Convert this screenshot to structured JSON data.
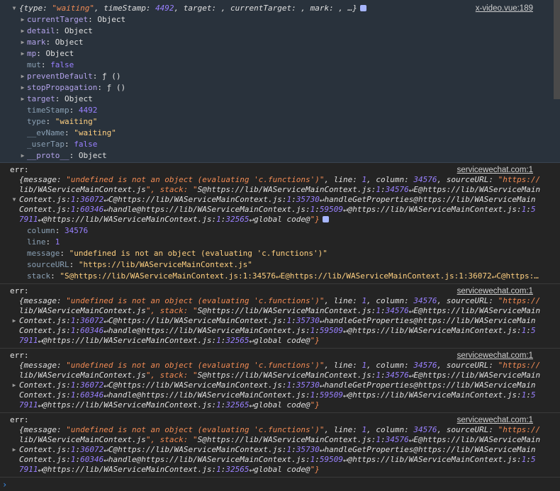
{
  "first_entry": {
    "summary_prefix": "{type: ",
    "summary_type": "\"waiting\"",
    "summary_mid": ", timeStamp: ",
    "summary_ts": "4492",
    "summary_rest": ", target: , currentTarget: , mark: , …}",
    "source": "x-video.vue:189",
    "props": [
      {
        "key": "currentTarget",
        "sep": ": ",
        "value": "Object",
        "expandable": true,
        "kind": "plain"
      },
      {
        "key": "detail",
        "sep": ": ",
        "value": "Object",
        "expandable": true,
        "kind": "plain"
      },
      {
        "key": "mark",
        "sep": ": ",
        "value": "Object",
        "expandable": true,
        "kind": "plain"
      },
      {
        "key": "mp",
        "sep": ": ",
        "value": "Object",
        "expandable": true,
        "kind": "plain"
      },
      {
        "key": "mut",
        "sep": ": ",
        "value": "false",
        "expandable": false,
        "kind": "bool"
      },
      {
        "key": "preventDefault",
        "sep": ": ",
        "value": "ƒ ()",
        "expandable": true,
        "kind": "plain"
      },
      {
        "key": "stopPropagation",
        "sep": ": ",
        "value": "ƒ ()",
        "expandable": true,
        "kind": "plain"
      },
      {
        "key": "target",
        "sep": ": ",
        "value": "Object",
        "expandable": true,
        "kind": "plain"
      },
      {
        "key": "timeStamp",
        "sep": ": ",
        "value": "4492",
        "expandable": false,
        "kind": "num"
      },
      {
        "key": "type",
        "sep": ": ",
        "value": "\"waiting\"",
        "expandable": false,
        "kind": "str"
      },
      {
        "key": "__evName",
        "sep": ": ",
        "value": "\"waiting\"",
        "expandable": false,
        "kind": "str"
      },
      {
        "key": "_userTap",
        "sep": ": ",
        "value": "false",
        "expandable": false,
        "kind": "bool"
      },
      {
        "key": "__proto__",
        "sep": ": ",
        "value": "Object",
        "expandable": true,
        "kind": "plain"
      }
    ]
  },
  "err_entries": [
    {
      "label": "err:",
      "source": "servicewechat.com:1",
      "expanded": true,
      "lines": [
        "{message: \"undefined is not an object (evaluating 'c.functions')\", line: 1, column: 34576, sourceURL: \"https://",
        "lib/WAService​MainContext.js\", stack: \"S@https://lib/WAServiceMainContext.js:1:34576↵E@https://lib/WAServiceMain",
        "Context.js:1:36072↵C@https://lib/WAServiceMainContext.js:1:35730↵handleGetProperties@https://lib/WAServiceMain",
        "Context.js:1:60346↵handle@https://lib/WAServiceMainContext.js:1:59509↵@https://lib/WAServiceMainContext.js:1:5",
        "7911↵@https://lib/WAServiceMainContext.js:1:32565↵global code@\"}"
      ],
      "props": [
        {
          "key": "column",
          "value": "34576",
          "kind": "num"
        },
        {
          "key": "line",
          "value": "1",
          "kind": "num"
        },
        {
          "key": "message",
          "value": "\"undefined is not an object (evaluating 'c.functions')\"",
          "kind": "strw"
        },
        {
          "key": "sourceURL",
          "value": "\"https://lib/WAServiceMainContext.js\"",
          "kind": "strw"
        },
        {
          "key": "stack",
          "value": "\"S@https://lib/WAServiceMainContext.js:1:34576↵E@https://lib/WAServiceMainContext.js:1:36072↵C@https:…",
          "kind": "strw"
        }
      ]
    },
    {
      "label": "err:",
      "source": "servicewechat.com:1",
      "expanded": false,
      "lines": [
        "{message: \"undefined is not an object (evaluating 'c.functions')\", line: 1, column: 34576, sourceURL: \"https://",
        "lib/WAServiceMainContext.js\", stack: \"S@https://lib/WAServiceMainContext.js:1:34576↵E@https://lib/WAServiceMain",
        "Context.js:1:36072↵C@https://lib/WAServiceMainContext.js:1:35730↵handleGetProperties@https://lib/WAServiceMain",
        "Context.js:1:60346↵handle@https://lib/WAServiceMainContext.js:1:59509↵@https://lib/WAServiceMainContext.js:1:5",
        "7911↵@https://lib/WAServiceMainContext.js:1:32565↵global code@\"}"
      ]
    },
    {
      "label": "err:",
      "source": "servicewechat.com:1",
      "expanded": false,
      "lines": [
        "{message: \"undefined is not an object (evaluating 'c.functions')\", line: 1, column: 34576, sourceURL: \"https://",
        "lib/WAServiceMainContext.js\", stack: \"S@https://lib/WAServiceMainContext.js:1:34576↵E@https://lib/WAServiceMain",
        "Context.js:1:36072↵C@https://lib/WAServiceMainContext.js:1:35730↵handleGetProperties@https://lib/WAServiceMain",
        "Context.js:1:60346↵handle@https://lib/WAServiceMainContext.js:1:59509↵@https://lib/WAServiceMainContext.js:1:5",
        "7911↵@https://lib/WAServiceMainContext.js:1:32565↵global code@\"}"
      ]
    },
    {
      "label": "err:",
      "source": "servicewechat.com:1",
      "expanded": false,
      "lines": [
        "{message: \"undefined is not an object (evaluating 'c.functions')\", line: 1, column: 34576, sourceURL: \"https://",
        "lib/WAServiceMainContext.js\", stack: \"S@https://lib/WAServiceMainContext.js:1:34576↵E@https://lib/WAServiceMain",
        "Context.js:1:36072↵C@https://lib/WAServiceMainContext.js:1:35730↵handleGetProperties@https://lib/WAServiceMain",
        "Context.js:1:60346↵handle@https://lib/WAServiceMainContext.js:1:59509↵@https://lib/WAServiceMainContext.js:1:5",
        "7911↵@https://lib/WAServiceMainContext.js:1:32565↵global code@\"}"
      ]
    }
  ],
  "prompt_symbol": "›",
  "colors": {
    "background": "#242424",
    "first_entry_bg": "#29323c",
    "string": "#f28b54",
    "number": "#9980ff",
    "link": "#3b8eea"
  }
}
